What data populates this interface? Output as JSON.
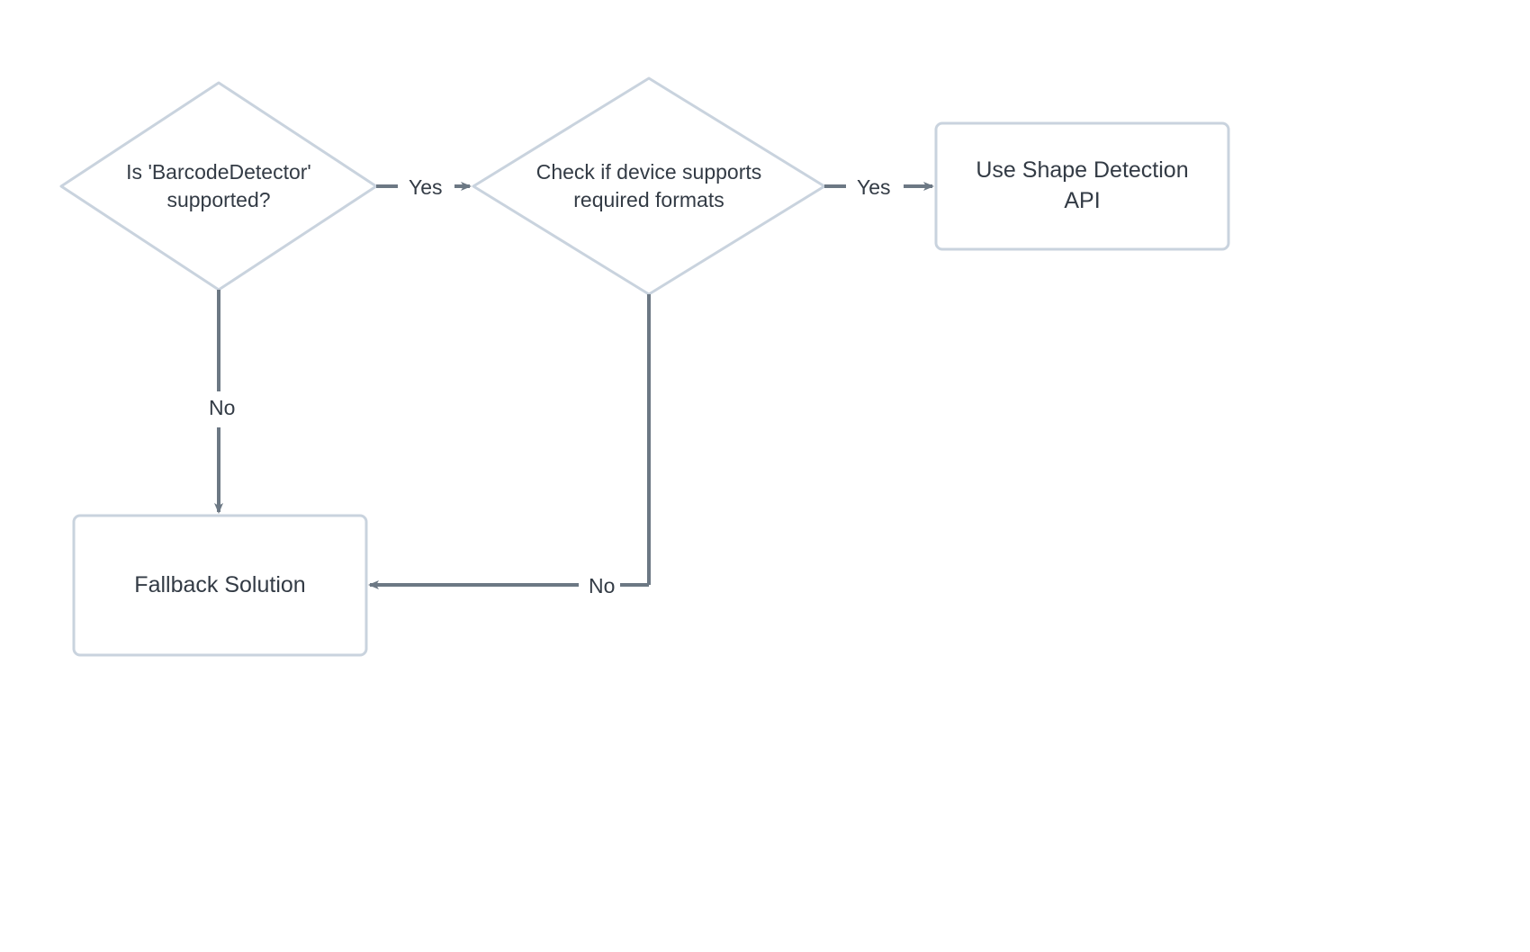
{
  "diagram": {
    "nodes": {
      "decision1": {
        "line1": "Is 'BarcodeDetector'",
        "line2": "supported?"
      },
      "decision2": {
        "line1": "Check if device supports",
        "line2": "required formats"
      },
      "result_api": {
        "line1": "Use Shape Detection",
        "line2": "API"
      },
      "result_fallback": "Fallback Solution"
    },
    "edges": {
      "d1_yes": "Yes",
      "d1_no": "No",
      "d2_yes": "Yes",
      "d2_no": "No"
    },
    "colors": {
      "node_stroke": "#c9d3de",
      "arrow_stroke": "#6c7884",
      "text": "#333b45"
    }
  }
}
